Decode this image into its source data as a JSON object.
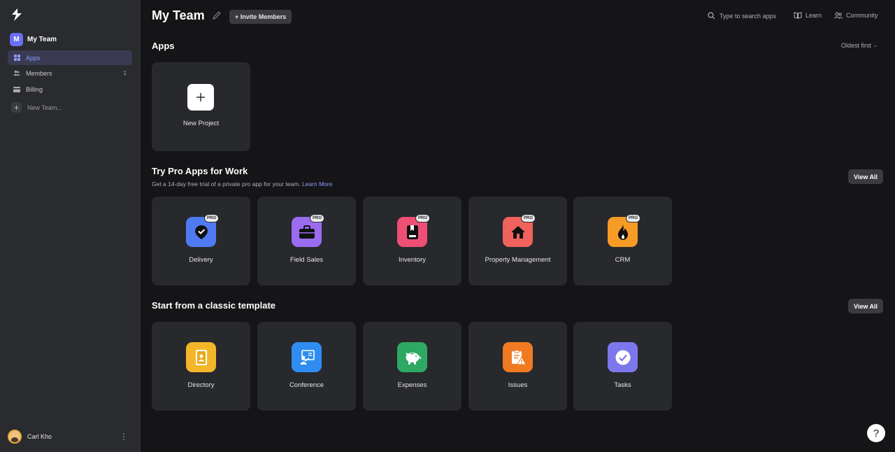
{
  "sidebar": {
    "logo_icon": "bolt-logo-icon",
    "team": {
      "initial": "M",
      "name": "My Team"
    },
    "nav": [
      {
        "label": "Apps",
        "icon": "grid-icon",
        "active": true
      },
      {
        "label": "Members",
        "icon": "people-icon",
        "count": "1"
      },
      {
        "label": "Billing",
        "icon": "card-icon"
      }
    ],
    "new_team_label": "New Team...",
    "user": {
      "name": "Carl Kho"
    }
  },
  "header": {
    "title": "My Team",
    "invite_label": "+ Invite Members",
    "search_placeholder": "Type to search apps",
    "learn_label": "Learn",
    "community_label": "Community"
  },
  "apps": {
    "title": "Apps",
    "sort_label": "Oldest first",
    "new_project_label": "New Project"
  },
  "pro": {
    "title": "Try Pro Apps for Work",
    "subtitle": "Get a 14-day free trial of a private pro app for your team.",
    "learn_more": "Learn More",
    "view_all": "View All",
    "badge": "PRO",
    "items": [
      {
        "label": "Delivery",
        "icon": "map-pin-check-icon",
        "color": "#4f7bf2"
      },
      {
        "label": "Field Sales",
        "icon": "briefcase-icon",
        "color": "#9b6cf2"
      },
      {
        "label": "Inventory",
        "icon": "book-icon",
        "color": "#ef4f74"
      },
      {
        "label": "Property Management",
        "icon": "house-icon",
        "color": "#f0625c"
      },
      {
        "label": "CRM",
        "icon": "flame-icon",
        "color": "#f59b26"
      }
    ]
  },
  "templates": {
    "title": "Start from a classic template",
    "view_all": "View All",
    "items": [
      {
        "label": "Directory",
        "icon": "contact-book-icon",
        "color": "#f3b62b"
      },
      {
        "label": "Conference",
        "icon": "presenter-icon",
        "color": "#2f8df1"
      },
      {
        "label": "Expenses",
        "icon": "piggy-bank-icon",
        "color": "#2ea862"
      },
      {
        "label": "Issues",
        "icon": "clipboard-warning-icon",
        "color": "#f07a22"
      },
      {
        "label": "Tasks",
        "icon": "check-circle-icon",
        "color": "#7d77ee"
      }
    ]
  },
  "help_label": "?"
}
